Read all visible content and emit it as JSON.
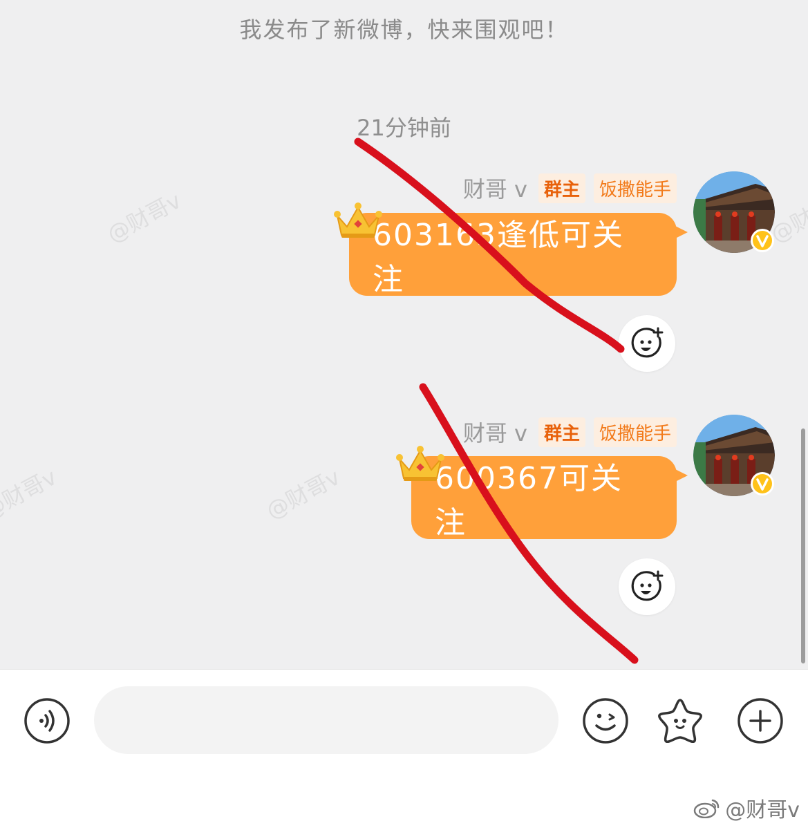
{
  "system_note": "我发布了新微博，快来围观吧！",
  "timestamp": "21分钟前",
  "watermark": "@财哥v",
  "messages": [
    {
      "sender": "财哥 v",
      "badges": [
        "群主",
        "饭撒能手"
      ],
      "text": "603163逢低可关注",
      "avatar_icon": "temple-photo-avatar",
      "verified_icon": "verified-v-badge",
      "decoration_icon": "crown-icon",
      "reaction_icon": "add-emoji-reaction-icon"
    },
    {
      "sender": "财哥 v",
      "badges": [
        "群主",
        "饭撒能手"
      ],
      "text": "600367可关注",
      "avatar_icon": "temple-photo-avatar",
      "verified_icon": "verified-v-badge",
      "decoration_icon": "crown-icon",
      "reaction_icon": "add-emoji-reaction-icon"
    }
  ],
  "input_bar": {
    "placeholder": "",
    "icons": [
      "voice-icon",
      "emoji-icon",
      "sticker-star-icon",
      "plus-icon"
    ]
  },
  "footer_watermark": {
    "logo_icon": "weibo-logo-icon",
    "text": "@财哥v"
  },
  "colors": {
    "chat_bg": "#efeff0",
    "bubble": "#ffa03a",
    "badge_text": "#f27a1a",
    "badge_bg": "#fdeee0",
    "annotation_red": "#d8101c",
    "verified_yellow": "#ffc21a"
  }
}
